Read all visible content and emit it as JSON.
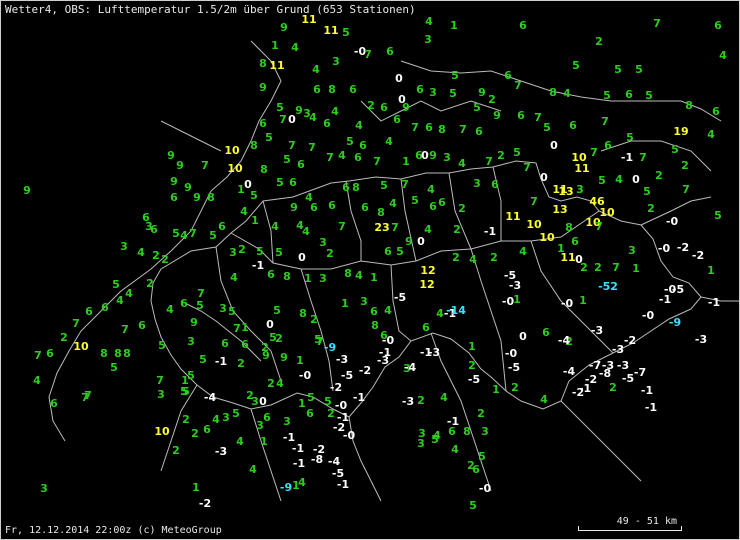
{
  "header": {
    "title": "Wetter4, OBS: Lufttemperatur 1.5/2m über Grund (653 Stationen)"
  },
  "footer": {
    "text": "Fr, 12.12.2014 22:00z (c) MeteoGroup"
  },
  "scale": {
    "label": "49 - 51 km"
  },
  "colors": {
    "positive": "#2ecc1f",
    "warm": "#ffff33",
    "negative": "#ffffff",
    "cold": "#33e6ff",
    "border": "#bbbbbb"
  },
  "stations": [
    [
      "9",
      283,
      30
    ],
    [
      "11",
      308,
      22
    ],
    [
      "11",
      330,
      33
    ],
    [
      "5",
      345,
      35
    ],
    [
      "4",
      428,
      24
    ],
    [
      "1",
      453,
      28
    ],
    [
      "3",
      427,
      42
    ],
    [
      "6",
      522,
      28
    ],
    [
      "7",
      656,
      26
    ],
    [
      "6",
      717,
      28
    ],
    [
      "2",
      598,
      44
    ],
    [
      "1",
      274,
      48
    ],
    [
      "4",
      294,
      50
    ],
    [
      "3",
      335,
      64
    ],
    [
      "-0",
      359,
      54
    ],
    [
      "7",
      367,
      57
    ],
    [
      "6",
      389,
      54
    ],
    [
      "5",
      575,
      68
    ],
    [
      "5",
      617,
      72
    ],
    [
      "5",
      638,
      72
    ],
    [
      "4",
      722,
      58
    ],
    [
      "8",
      262,
      66
    ],
    [
      "11",
      276,
      68
    ],
    [
      "4",
      315,
      72
    ],
    [
      "9",
      262,
      90
    ],
    [
      "6",
      316,
      92
    ],
    [
      "8",
      331,
      92
    ],
    [
      "6",
      352,
      92
    ],
    [
      "0",
      398,
      81
    ],
    [
      "0",
      401,
      102
    ],
    [
      "5",
      454,
      78
    ],
    [
      "6",
      507,
      78
    ],
    [
      "7",
      517,
      88
    ],
    [
      "6",
      419,
      92
    ],
    [
      "3",
      432,
      95
    ],
    [
      "5",
      452,
      96
    ],
    [
      "9",
      481,
      95
    ],
    [
      "2",
      491,
      102
    ],
    [
      "8",
      552,
      95
    ],
    [
      "4",
      566,
      96
    ],
    [
      "5",
      606,
      98
    ],
    [
      "6",
      628,
      97
    ],
    [
      "5",
      648,
      98
    ],
    [
      "8",
      688,
      108
    ],
    [
      "6",
      715,
      114
    ],
    [
      "5",
      279,
      110
    ],
    [
      "9",
      298,
      113
    ],
    [
      "3",
      306,
      116
    ],
    [
      "4",
      334,
      114
    ],
    [
      "2",
      370,
      108
    ],
    [
      "6",
      383,
      110
    ],
    [
      "4",
      358,
      128
    ],
    [
      "6",
      396,
      122
    ],
    [
      "9",
      405,
      110
    ],
    [
      "5",
      476,
      110
    ],
    [
      "9",
      496,
      118
    ],
    [
      "6",
      520,
      118
    ],
    [
      "7",
      537,
      120
    ],
    [
      "6",
      262,
      126
    ],
    [
      "7",
      282,
      122
    ],
    [
      "0",
      291,
      122
    ],
    [
      "4",
      312,
      120
    ],
    [
      "6",
      326,
      126
    ],
    [
      "7",
      414,
      130
    ],
    [
      "6",
      428,
      130
    ],
    [
      "8",
      441,
      132
    ],
    [
      "7",
      462,
      132
    ],
    [
      "6",
      478,
      134
    ],
    [
      "5",
      546,
      130
    ],
    [
      "6",
      572,
      128
    ],
    [
      "7",
      604,
      124
    ],
    [
      "5",
      629,
      140
    ],
    [
      "19",
      680,
      134
    ],
    [
      "4",
      710,
      137
    ],
    [
      "9",
      170,
      158
    ],
    [
      "9",
      179,
      168
    ],
    [
      "7",
      204,
      168
    ],
    [
      "10",
      231,
      153
    ],
    [
      "8",
      253,
      148
    ],
    [
      "5",
      268,
      140
    ],
    [
      "7",
      291,
      148
    ],
    [
      "7",
      311,
      150
    ],
    [
      "5",
      349,
      144
    ],
    [
      "6",
      362,
      148
    ],
    [
      "4",
      388,
      144
    ],
    [
      "6",
      418,
      158
    ],
    [
      "9",
      432,
      158
    ],
    [
      "4",
      461,
      166
    ],
    [
      "2",
      500,
      158
    ],
    [
      "5",
      516,
      155
    ],
    [
      "0",
      553,
      148
    ],
    [
      "10",
      578,
      160
    ],
    [
      "7",
      593,
      155
    ],
    [
      "6",
      607,
      148
    ],
    [
      "-1",
      626,
      160
    ],
    [
      "7",
      642,
      160
    ],
    [
      "5",
      674,
      152
    ],
    [
      "2",
      684,
      168
    ],
    [
      "9",
      26,
      193
    ],
    [
      "9",
      173,
      184
    ],
    [
      "9",
      187,
      190
    ],
    [
      "10",
      234,
      171
    ],
    [
      "8",
      263,
      172
    ],
    [
      "5",
      286,
      162
    ],
    [
      "6",
      300,
      167
    ],
    [
      "7",
      329,
      160
    ],
    [
      "4",
      341,
      158
    ],
    [
      "6",
      357,
      160
    ],
    [
      "7",
      376,
      164
    ],
    [
      "1",
      405,
      164
    ],
    [
      "0",
      424,
      158
    ],
    [
      "3",
      446,
      160
    ],
    [
      "7",
      488,
      164
    ],
    [
      "7",
      526,
      170
    ],
    [
      "11",
      581,
      171
    ],
    [
      "5",
      601,
      183
    ],
    [
      "4",
      618,
      182
    ],
    [
      "0",
      635,
      182
    ],
    [
      "5",
      646,
      194
    ],
    [
      "2",
      658,
      178
    ],
    [
      "7",
      685,
      192
    ],
    [
      "6",
      173,
      200
    ],
    [
      "9",
      196,
      200
    ],
    [
      "8",
      210,
      200
    ],
    [
      "1",
      240,
      192
    ],
    [
      "0",
      247,
      187
    ],
    [
      "5",
      253,
      198
    ],
    [
      "5",
      279,
      185
    ],
    [
      "6",
      292,
      185
    ],
    [
      "4",
      308,
      200
    ],
    [
      "6",
      345,
      190
    ],
    [
      "8",
      355,
      190
    ],
    [
      "5",
      383,
      188
    ],
    [
      "7",
      404,
      187
    ],
    [
      "4",
      430,
      192
    ],
    [
      "3",
      476,
      186
    ],
    [
      "6",
      494,
      187
    ],
    [
      "0",
      543,
      180
    ],
    [
      "11",
      559,
      192
    ],
    [
      "13",
      565,
      194
    ],
    [
      "3",
      579,
      192
    ],
    [
      "2",
      650,
      211
    ],
    [
      "-0",
      671,
      224
    ],
    [
      "5",
      717,
      218
    ],
    [
      "6",
      145,
      220
    ],
    [
      "6",
      153,
      232
    ],
    [
      "5",
      175,
      236
    ],
    [
      "7",
      192,
      236
    ],
    [
      "6",
      221,
      229
    ],
    [
      "4",
      243,
      214
    ],
    [
      "1",
      254,
      223
    ],
    [
      "9",
      293,
      210
    ],
    [
      "6",
      313,
      210
    ],
    [
      "6",
      331,
      208
    ],
    [
      "6",
      364,
      210
    ],
    [
      "8",
      380,
      215
    ],
    [
      "4",
      392,
      206
    ],
    [
      "5",
      414,
      203
    ],
    [
      "6",
      432,
      209
    ],
    [
      "6",
      441,
      205
    ],
    [
      "2",
      461,
      211
    ],
    [
      "11",
      512,
      219
    ],
    [
      "7",
      533,
      204
    ],
    [
      "13",
      559,
      212
    ],
    [
      "46",
      596,
      204
    ],
    [
      "10",
      606,
      215
    ],
    [
      "3",
      148,
      229
    ],
    [
      "4",
      183,
      238
    ],
    [
      "5",
      212,
      238
    ],
    [
      "2",
      241,
      252
    ],
    [
      "5",
      259,
      254
    ],
    [
      "4",
      274,
      229
    ],
    [
      "4",
      299,
      228
    ],
    [
      "4",
      305,
      234
    ],
    [
      "3",
      322,
      245
    ],
    [
      "7",
      341,
      229
    ],
    [
      "23",
      381,
      230
    ],
    [
      "7",
      394,
      230
    ],
    [
      "4",
      427,
      232
    ],
    [
      "2",
      456,
      232
    ],
    [
      "-1",
      489,
      234
    ],
    [
      "10",
      533,
      227
    ],
    [
      "10",
      546,
      240
    ],
    [
      "8",
      568,
      230
    ],
    [
      "10",
      592,
      225
    ],
    [
      "7",
      598,
      229
    ],
    [
      "-0",
      663,
      251
    ],
    [
      "-2",
      682,
      250
    ],
    [
      "-2",
      697,
      258
    ],
    [
      "3",
      123,
      249
    ],
    [
      "4",
      140,
      255
    ],
    [
      "2",
      155,
      258
    ],
    [
      "2",
      164,
      262
    ],
    [
      "3",
      232,
      255
    ],
    [
      "-1",
      257,
      268
    ],
    [
      "5",
      278,
      255
    ],
    [
      "0",
      301,
      260
    ],
    [
      "2",
      329,
      256
    ],
    [
      "6",
      387,
      254
    ],
    [
      "5",
      399,
      254
    ],
    [
      "9",
      408,
      244
    ],
    [
      "0",
      420,
      244
    ],
    [
      "2",
      455,
      260
    ],
    [
      "4",
      472,
      262
    ],
    [
      "2",
      493,
      260
    ],
    [
      "4",
      522,
      254
    ],
    [
      "1",
      560,
      251
    ],
    [
      "11",
      567,
      260
    ],
    [
      "6",
      574,
      244
    ],
    [
      "0",
      578,
      262
    ],
    [
      "3",
      631,
      253
    ],
    [
      "5",
      115,
      287
    ],
    [
      "4",
      128,
      296
    ],
    [
      "2",
      149,
      286
    ],
    [
      "7",
      200,
      296
    ],
    [
      "4",
      233,
      280
    ],
    [
      "6",
      270,
      277
    ],
    [
      "8",
      286,
      279
    ],
    [
      "1",
      307,
      281
    ],
    [
      "3",
      322,
      281
    ],
    [
      "8",
      347,
      276
    ],
    [
      "4",
      358,
      278
    ],
    [
      "1",
      373,
      280
    ],
    [
      "12",
      427,
      273
    ],
    [
      "12",
      426,
      287
    ],
    [
      "-5",
      509,
      278
    ],
    [
      "-3",
      514,
      288
    ],
    [
      "2",
      583,
      270
    ],
    [
      "2",
      597,
      270
    ],
    [
      "7",
      615,
      270
    ],
    [
      "1",
      635,
      271
    ],
    [
      "-52",
      607,
      289
    ],
    [
      "-0",
      669,
      292
    ],
    [
      "1",
      710,
      273
    ],
    [
      "6",
      88,
      314
    ],
    [
      "6",
      104,
      310
    ],
    [
      "4",
      119,
      303
    ],
    [
      "6",
      183,
      306
    ],
    [
      "5",
      199,
      308
    ],
    [
      "3",
      222,
      311
    ],
    [
      "5",
      231,
      314
    ],
    [
      "5",
      276,
      313
    ],
    [
      "8",
      302,
      316
    ],
    [
      "2",
      313,
      322
    ],
    [
      "1",
      344,
      306
    ],
    [
      "3",
      363,
      304
    ],
    [
      "6",
      373,
      314
    ],
    [
      "4",
      387,
      313
    ],
    [
      "-5",
      399,
      300
    ],
    [
      "6",
      425,
      330
    ],
    [
      "-1",
      449,
      316
    ],
    [
      "4",
      439,
      316
    ],
    [
      "-0",
      507,
      304
    ],
    [
      "1",
      516,
      302
    ],
    [
      "-0",
      566,
      306
    ],
    [
      "1",
      582,
      303
    ],
    [
      "-1",
      664,
      302
    ],
    [
      "-5",
      677,
      292
    ],
    [
      "-1",
      713,
      305
    ],
    [
      "7",
      75,
      326
    ],
    [
      "7",
      124,
      332
    ],
    [
      "6",
      141,
      328
    ],
    [
      "4",
      169,
      312
    ],
    [
      "9",
      193,
      325
    ],
    [
      "3",
      190,
      344
    ],
    [
      "7",
      236,
      331
    ],
    [
      "1",
      244,
      330
    ],
    [
      "0",
      269,
      327
    ],
    [
      "5",
      272,
      340
    ],
    [
      "5",
      317,
      342
    ],
    [
      "8",
      374,
      328
    ],
    [
      "6",
      383,
      338
    ],
    [
      "-14",
      455,
      313
    ],
    [
      "0",
      522,
      339
    ],
    [
      "6",
      545,
      335
    ],
    [
      "2",
      568,
      344
    ],
    [
      "-3",
      596,
      333
    ],
    [
      "-0",
      647,
      318
    ],
    [
      "-9",
      674,
      325
    ],
    [
      "-3",
      700,
      342
    ],
    [
      "2",
      63,
      340
    ],
    [
      "10",
      80,
      349
    ],
    [
      "8",
      103,
      356
    ],
    [
      "8",
      117,
      356
    ],
    [
      "8",
      126,
      356
    ],
    [
      "5",
      161,
      348
    ],
    [
      "5",
      202,
      362
    ],
    [
      "6",
      224,
      346
    ],
    [
      "6",
      244,
      347
    ],
    [
      "2",
      264,
      350
    ],
    [
      "2",
      278,
      341
    ],
    [
      "7",
      319,
      344
    ],
    [
      "-9",
      329,
      350
    ],
    [
      "-0",
      387,
      343
    ],
    [
      "-1",
      384,
      355
    ],
    [
      "-1",
      425,
      355
    ],
    [
      "-3",
      433,
      355
    ],
    [
      "1",
      471,
      349
    ],
    [
      "-4",
      563,
      343
    ],
    [
      "-2",
      629,
      343
    ],
    [
      "-0",
      510,
      356
    ],
    [
      "7",
      37,
      358
    ],
    [
      "6",
      49,
      356
    ],
    [
      "5",
      113,
      370
    ],
    [
      "-1",
      220,
      364
    ],
    [
      "2",
      240,
      366
    ],
    [
      "9",
      265,
      358
    ],
    [
      "9",
      283,
      360
    ],
    [
      "1",
      299,
      363
    ],
    [
      "-3",
      341,
      362
    ],
    [
      "-3",
      382,
      363
    ],
    [
      "3",
      406,
      371
    ],
    [
      "2",
      471,
      368
    ],
    [
      "-5",
      513,
      370
    ],
    [
      "-7",
      594,
      368
    ],
    [
      "-3",
      607,
      368
    ],
    [
      "-3",
      622,
      368
    ],
    [
      "-3",
      617,
      352
    ],
    [
      "4",
      36,
      383
    ],
    [
      "7",
      159,
      383
    ],
    [
      "1",
      184,
      383
    ],
    [
      "5",
      190,
      378
    ],
    [
      "4",
      279,
      386
    ],
    [
      "2",
      270,
      386
    ],
    [
      "-0",
      304,
      378
    ],
    [
      "-5",
      346,
      378
    ],
    [
      "-2",
      364,
      373
    ],
    [
      "-4",
      409,
      370
    ],
    [
      "-5",
      473,
      382
    ],
    [
      "-4",
      568,
      374
    ],
    [
      "-2",
      590,
      382
    ],
    [
      "-8",
      604,
      376
    ],
    [
      "-5",
      627,
      381
    ],
    [
      "-7",
      639,
      375
    ],
    [
      "6",
      53,
      406
    ],
    [
      "7",
      84,
      400
    ],
    [
      "3",
      160,
      397
    ],
    [
      "5",
      183,
      394
    ],
    [
      "-4",
      209,
      400
    ],
    [
      "2",
      249,
      398
    ],
    [
      "3",
      254,
      404
    ],
    [
      "0",
      262,
      404
    ],
    [
      "-2",
      335,
      390
    ],
    [
      "-1",
      358,
      400
    ],
    [
      "-3",
      407,
      404
    ],
    [
      "2",
      420,
      403
    ],
    [
      "4",
      443,
      400
    ],
    [
      "1",
      495,
      392
    ],
    [
      "2",
      514,
      390
    ],
    [
      "4",
      543,
      402
    ],
    [
      "-2",
      577,
      395
    ],
    [
      "-1",
      584,
      391
    ],
    [
      "2",
      612,
      390
    ],
    [
      "-1",
      646,
      393
    ],
    [
      "7",
      87,
      398
    ],
    [
      "5",
      185,
      394
    ],
    [
      "5",
      235,
      416
    ],
    [
      "3",
      225,
      420
    ],
    [
      "4",
      215,
      422
    ],
    [
      "1",
      301,
      406
    ],
    [
      "5",
      310,
      400
    ],
    [
      "5",
      327,
      404
    ],
    [
      "6",
      309,
      416
    ],
    [
      "-0",
      340,
      408
    ],
    [
      "2",
      330,
      416
    ],
    [
      "-1",
      342,
      420
    ],
    [
      "2",
      480,
      416
    ],
    [
      "-1",
      650,
      410
    ],
    [
      "10",
      161,
      434
    ],
    [
      "2",
      185,
      422
    ],
    [
      "2",
      194,
      436
    ],
    [
      "6",
      206,
      432
    ],
    [
      "4",
      239,
      444
    ],
    [
      "6",
      266,
      420
    ],
    [
      "3",
      259,
      428
    ],
    [
      "3",
      286,
      424
    ],
    [
      "-2",
      338,
      430
    ],
    [
      "-0",
      348,
      438
    ],
    [
      "3",
      421,
      436
    ],
    [
      "5",
      434,
      442
    ],
    [
      "6",
      451,
      434
    ],
    [
      "8",
      466,
      434
    ],
    [
      "3",
      484,
      434
    ],
    [
      "-1",
      452,
      424
    ],
    [
      "2",
      175,
      453
    ],
    [
      "-3",
      220,
      454
    ],
    [
      "1",
      263,
      444
    ],
    [
      "-1",
      288,
      440
    ],
    [
      "-2",
      318,
      452
    ],
    [
      "-1",
      297,
      451
    ],
    [
      "-1",
      298,
      466
    ],
    [
      "-8",
      316,
      462
    ],
    [
      "4",
      454,
      452
    ],
    [
      "3",
      420,
      446
    ],
    [
      "5",
      481,
      459
    ],
    [
      "4",
      436,
      438
    ],
    [
      "3",
      43,
      491
    ],
    [
      "4",
      252,
      472
    ],
    [
      "-4",
      333,
      464
    ],
    [
      "2",
      470,
      468
    ],
    [
      "6",
      475,
      472
    ],
    [
      "-5",
      337,
      476
    ],
    [
      "-1",
      342,
      487
    ],
    [
      "4",
      301,
      485
    ],
    [
      "-9",
      285,
      490
    ],
    [
      "1",
      295,
      488
    ],
    [
      "1",
      195,
      490
    ],
    [
      "-2",
      204,
      506
    ],
    [
      "-0",
      484,
      491
    ],
    [
      "5",
      472,
      508
    ]
  ]
}
